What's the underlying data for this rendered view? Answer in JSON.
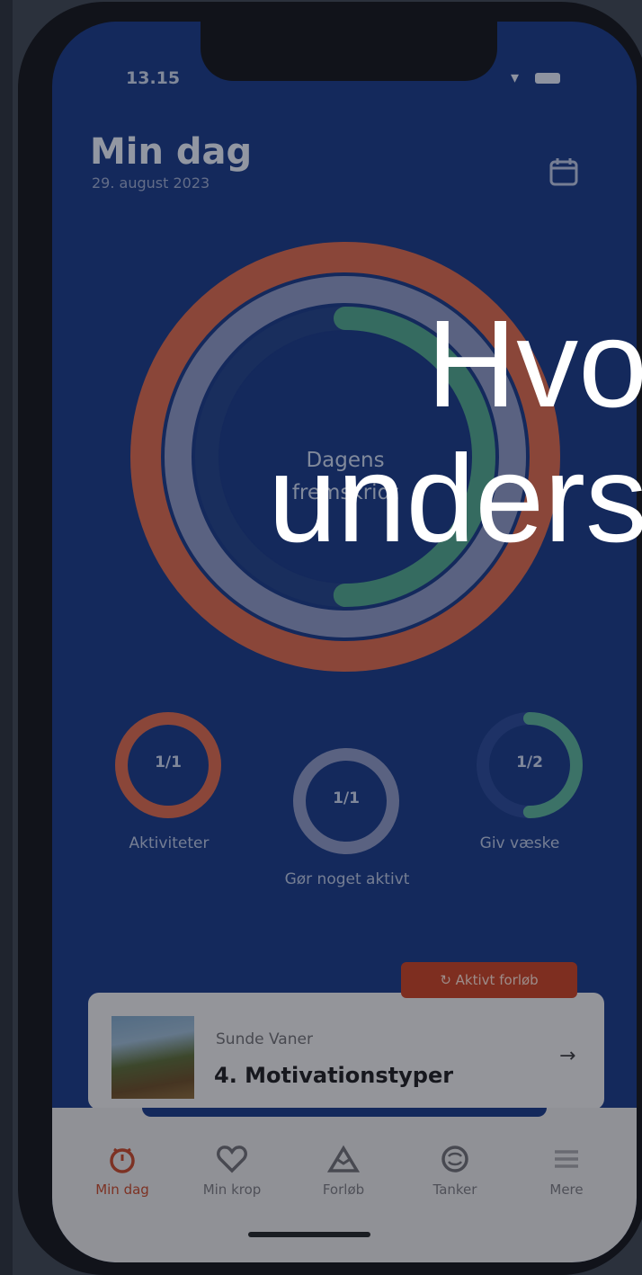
{
  "status_bar": {
    "time": "13.15"
  },
  "header": {
    "title": "Min dag",
    "date": "29. august 2023"
  },
  "progress": {
    "center_label_line1": "Dagens",
    "center_label_line2": "fremskridt",
    "outer_ring_fraction": 1.0,
    "middle_ring_fraction": 1.0,
    "inner_ring_fraction": 0.5,
    "colors": {
      "outer": "#d9694f",
      "middle": "#8b97c4",
      "inner": "#4fa58f"
    }
  },
  "mini_rings": [
    {
      "value": "1/1",
      "label": "Aktiviteter",
      "fraction": 1.0,
      "color": "#d9694f"
    },
    {
      "value": "1/1",
      "label": "Gør noget aktivt",
      "fraction": 1.0,
      "color": "#8b97c4"
    },
    {
      "value": "1/2",
      "label": "Giv væske",
      "fraction": 0.5,
      "color": "#5bb09a"
    }
  ],
  "card": {
    "badge": "Aktivt forløb",
    "subtitle": "Sunde Vaner",
    "title": "4. Motivationstyper"
  },
  "tabs": [
    {
      "label": "Min dag",
      "icon": "clock-icon",
      "active": true
    },
    {
      "label": "Min krop",
      "icon": "heart-icon",
      "active": false
    },
    {
      "label": "Forløb",
      "icon": "mountain-icon",
      "active": false
    },
    {
      "label": "Tanker",
      "icon": "brain-icon",
      "active": false
    },
    {
      "label": "Mere",
      "icon": "menu-icon",
      "active": false
    }
  ],
  "overlay_text": {
    "line1": "Hvo",
    "line2": "unders"
  }
}
